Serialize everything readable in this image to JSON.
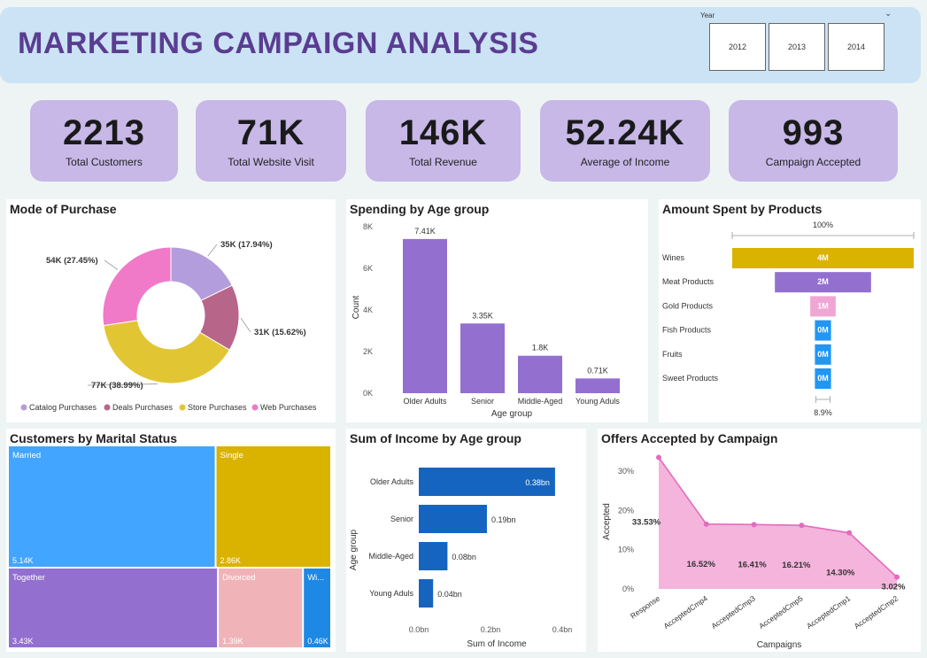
{
  "header": {
    "title": "MARKETING CAMPAIGN ANALYSIS",
    "slicer_label": "Year",
    "years": [
      "2012",
      "2013",
      "2014"
    ]
  },
  "kpis": [
    {
      "value": "2213",
      "label": "Total Customers"
    },
    {
      "value": "71K",
      "label": "Total Website Visit"
    },
    {
      "value": "146K",
      "label": "Total Revenue"
    },
    {
      "value": "52.24K",
      "label": "Average of Income"
    },
    {
      "value": "993",
      "label": "Campaign Accepted"
    }
  ],
  "colors": {
    "purple": "#9370cf",
    "pink": "#f07ac8",
    "gold": "#dab200",
    "blue": "#3fa3ff",
    "darkblue": "#1565c0",
    "rose": "#b8658a",
    "lavender": "#b39ddd",
    "lightpink": "#f0b4b8"
  },
  "chart_data": [
    {
      "id": "mode",
      "type": "pie",
      "title": "Mode of Purchase",
      "categories": [
        "Catalog Purchases",
        "Deals Purchases",
        "Store Purchases",
        "Web Purchases"
      ],
      "values": [
        35,
        31,
        77,
        54
      ],
      "data_labels": [
        "35K (17.94%)",
        "31K (15.62%)",
        "77K (38.99%)",
        "54K (27.45%)"
      ],
      "colors": [
        "#b39ddd",
        "#b8658a",
        "#e2c533",
        "#f07ac8"
      ],
      "legend": "bottom"
    },
    {
      "id": "age_spend",
      "type": "bar",
      "title": "Spending by Age group",
      "categories": [
        "Older Adults",
        "Senior",
        "Middle-Aged",
        "Young Aduls"
      ],
      "values": [
        7.41,
        3.35,
        1.8,
        0.71
      ],
      "data_labels": [
        "7.41K",
        "3.35K",
        "1.8K",
        "0.71K"
      ],
      "xlabel": "Age group",
      "ylabel": "Count",
      "ylim": [
        0,
        8
      ],
      "yticks": [
        "0K",
        "2K",
        "4K",
        "6K",
        "8K"
      ]
    },
    {
      "id": "products",
      "type": "bar",
      "title": "Amount Spent by Products",
      "categories": [
        "Wines",
        "Meat Products",
        "Gold Products",
        "Fish Products",
        "Fruits",
        "Sweet Products"
      ],
      "values": [
        4,
        2,
        1,
        0,
        0,
        0
      ],
      "bar_fraction": [
        1.0,
        0.53,
        0.14,
        0.089,
        0.089,
        0.089
      ],
      "data_labels": [
        "4M",
        "2M",
        "1M",
        "0M",
        "0M",
        "0M"
      ],
      "colors": [
        "#dab200",
        "#9370cf",
        "#f0a6d5",
        "#2196f3",
        "#2196f3",
        "#2196f3"
      ],
      "top_label": "100%",
      "bottom_label": "8.9%"
    },
    {
      "id": "marital",
      "type": "heatmap",
      "title": "Customers by Marital Status",
      "categories": [
        "Married",
        "Single",
        "Together",
        "Divorced",
        "Wi..."
      ],
      "values": [
        5.14,
        2.86,
        3.43,
        1.39,
        0.46
      ],
      "data_labels": [
        "5.14K",
        "2.86K",
        "3.43K",
        "1.39K",
        "0.46K"
      ],
      "colors": [
        "#42a5ff",
        "#dab200",
        "#9370cf",
        "#f0b4b8",
        "#1e88e5"
      ]
    },
    {
      "id": "income",
      "type": "bar",
      "title": "Sum of Income by Age group",
      "categories": [
        "Older Adults",
        "Senior",
        "Middle-Aged",
        "Young Aduls"
      ],
      "values": [
        0.38,
        0.19,
        0.08,
        0.04
      ],
      "data_labels": [
        "0.38bn",
        "0.19bn",
        "0.08bn",
        "0.04bn"
      ],
      "xlabel": "Sum of Income",
      "ylabel": "Age group",
      "xlim": [
        0,
        0.4
      ],
      "xticks": [
        "0.0bn",
        "0.2bn",
        "0.4bn"
      ]
    },
    {
      "id": "offers",
      "type": "area",
      "title": "Offers Accepted by Campaign",
      "categories": [
        "Response",
        "AcceptedCmp4",
        "AcceptedCmp3",
        "AcceptedCmp5",
        "AcceptedCmp1",
        "AcceptedCmp2"
      ],
      "values": [
        33.53,
        16.52,
        16.41,
        16.21,
        14.3,
        3.02
      ],
      "data_labels": [
        "33.53%",
        "16.52%",
        "16.41%",
        "16.21%",
        "14.30%",
        "3.02%"
      ],
      "xlabel": "Campaigns",
      "ylabel": "Accepted",
      "ylim": [
        0,
        35
      ],
      "yticks": [
        "0%",
        "10%",
        "20%",
        "30%"
      ]
    }
  ]
}
